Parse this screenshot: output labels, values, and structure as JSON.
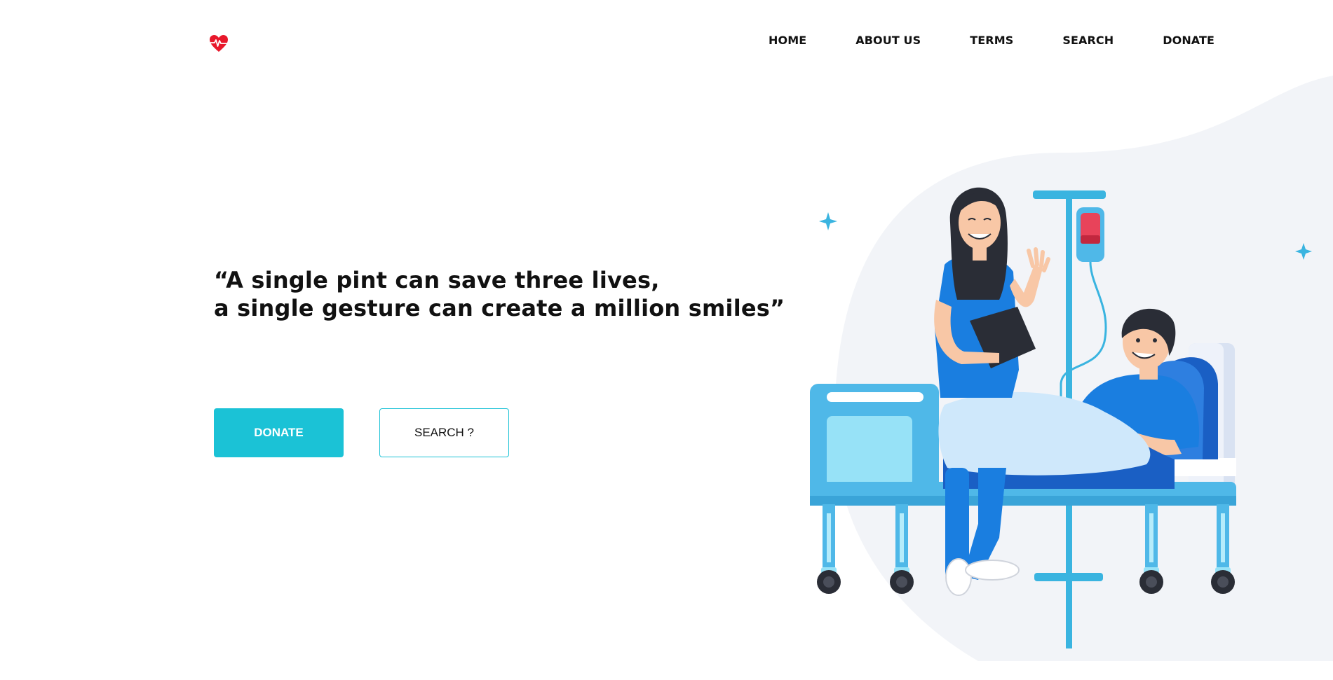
{
  "header": {
    "logo_icon": "heart-pulse-icon",
    "nav": [
      {
        "label": "HOME"
      },
      {
        "label": "ABOUT US"
      },
      {
        "label": "TERMS"
      },
      {
        "label": "SEARCH"
      },
      {
        "label": "DONATE"
      }
    ]
  },
  "hero": {
    "quote_line1": "“A single pint can save three lives,",
    "quote_line2": "a single gesture can create a million smiles”",
    "donate_label": "DONATE",
    "search_label": "SEARCH ?"
  },
  "illustration": {
    "name": "nurse-patient-hospital-bed-illustration",
    "colors": {
      "accent": "#1bc2d6",
      "blob": "#f2f4f8",
      "blue": "#1a7ee0",
      "light_blue": "#4fb8e8",
      "blood": "#e8435a"
    }
  },
  "colors": {
    "logo_red": "#e8182b",
    "text": "#111111",
    "button_teal": "#1bc2d6"
  }
}
